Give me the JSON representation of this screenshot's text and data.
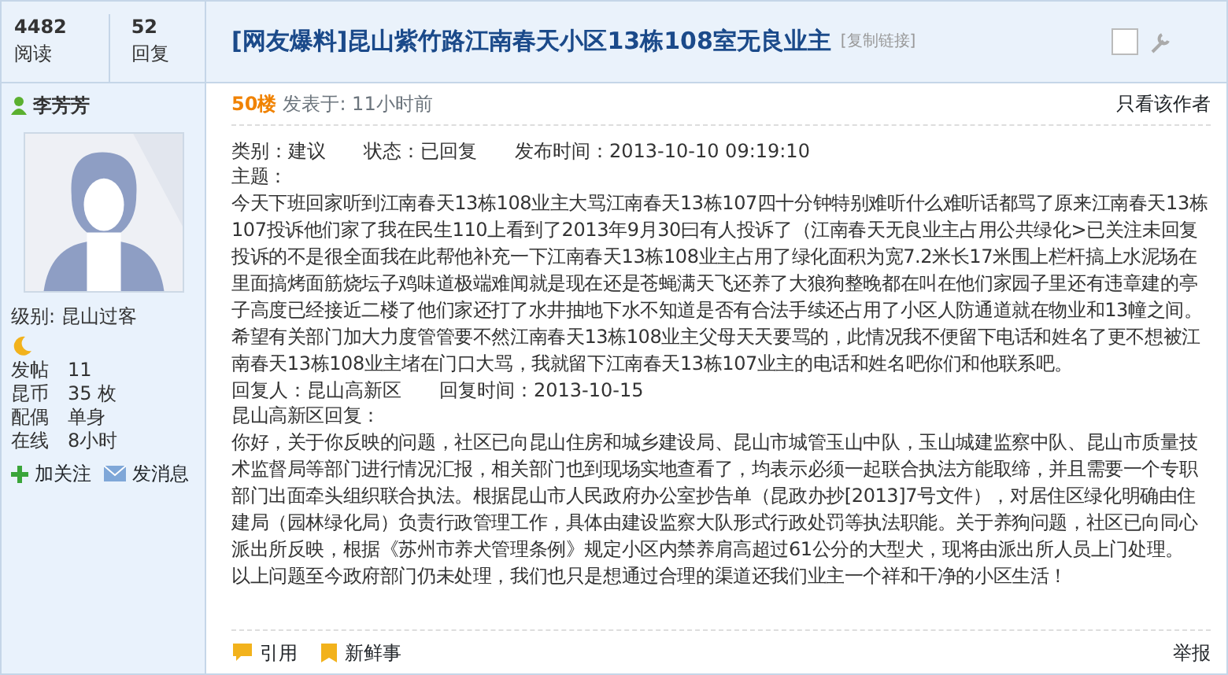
{
  "thread_stats": [
    {
      "value": "4482",
      "label": "阅读"
    },
    {
      "value": "52",
      "label": "回复"
    }
  ],
  "thread": {
    "tag": "[网友爆料]",
    "title": "昆山紫竹路江南春天小区13栋108室无良业主",
    "copy_link": "[复制链接]",
    "select_checkbox": {
      "checked": false
    }
  },
  "author": {
    "name": "李芳芳",
    "level": "级别: 昆山过客",
    "stats": [
      {
        "label": "发帖",
        "value": "11"
      },
      {
        "label": "昆币",
        "value": "35 枚"
      },
      {
        "label": "配偶",
        "value": "单身"
      },
      {
        "label": "在线",
        "value": "8小时"
      }
    ],
    "actions": [
      {
        "label": "加关注",
        "kind": "follow"
      },
      {
        "label": "发消息",
        "kind": "message"
      }
    ]
  },
  "post": {
    "floor": "50楼",
    "posted": "发表于: 11小时前",
    "author_only": "只看该作者",
    "meta": [
      {
        "label": "类别：",
        "value": "建议"
      },
      {
        "label": "状态：",
        "value": "已回复"
      },
      {
        "label": "发布时间：",
        "value": "2013-10-10 09:19:10"
      }
    ],
    "subject_label": "主题：",
    "body": "今天下班回家听到江南春天13栋108业主大骂江南春天13栋107四十分钟特别难听什么难听话都骂了原来江南春天13栋107投诉他们家了我在民生110上看到了2013年9月30曰有人投诉了（江南春天无良业主占用公共绿化>已关注未回复投诉的不是很全面我在此帮他补充一下江南春天13栋108业主占用了绿化面积为宽7.2米长17米围上栏杆搞上水泥场在里面搞烤面筋烧坛子鸡味道极端难闻就是现在还是苍蝇满天飞还养了大狼狗整晚都在叫在他们家园子里还有违章建的亭子高度已经接近二楼了他们家还打了水井抽地下水不知道是否有合法手续还占用了小区人防通道就在物业和13幢之间。希望有关部门加大力度管管要不然江南春天13栋108业主父母天天要骂的，此情况我不便留下电话和姓名了更不想被江南春天13栋108业主堵在门口大骂，我就留下江南春天13栋107业主的电话和姓名吧你们和他联系吧。",
    "reply_meta": [
      {
        "label": "回复人：",
        "value": "昆山高新区"
      },
      {
        "label": "回复时间：",
        "value": "2013-10-15"
      }
    ],
    "reply_heading": "昆山高新区回复：",
    "reply_body": "你好，关于你反映的问题，社区已向昆山住房和城乡建设局、昆山市城管玉山中队，玉山城建监察中队、昆山市质量技术监督局等部门进行情况汇报，相关部门也到现场实地查看了，均表示必须一起联合执法方能取缔，并且需要一个专职部门出面牵头组织联合执法。根据昆山市人民政府办公室抄告单（昆政办抄[2013]7号文件），对居住区绿化明确由住建局（园林绿化局）负责行政管理工作，具体由建设监察大队形式行政处罚等执法职能。关于养狗问题，社区已向同心派出所反映，根据《苏州市养犬管理条例》规定小区内禁养肩高超过61公分的大型犬，现将由派出所人员上门处理。",
    "closing": "以上问题至今政府部门仍未处理，我们也只是想通过合理的渠道还我们业主一个祥和干净的小区生活！"
  },
  "footer": {
    "actions": [
      {
        "label": "引用",
        "kind": "quote"
      },
      {
        "label": "新鲜事",
        "kind": "news"
      }
    ],
    "report": "举报"
  }
}
